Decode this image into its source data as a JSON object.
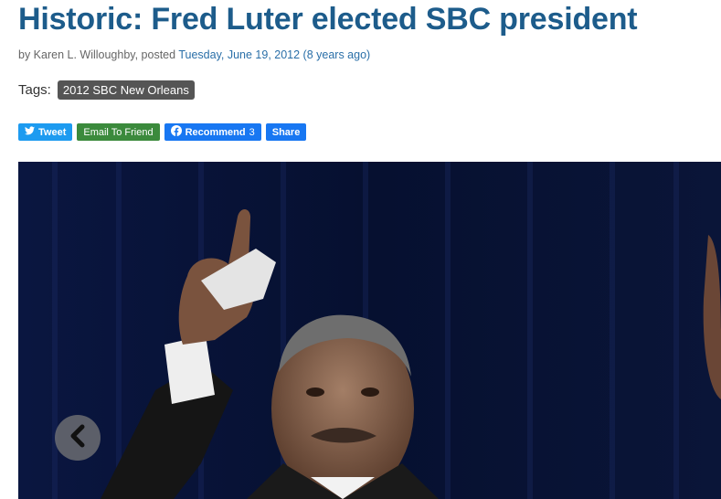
{
  "article": {
    "title": "Historic: Fred Luter elected SBC president",
    "byline_prefix": "by Karen L. Willoughby, posted ",
    "date_link": "Tuesday, June 19, 2012 (8 years ago)"
  },
  "tags": {
    "label": "Tags:",
    "items": [
      "2012 SBC New Orleans"
    ]
  },
  "share": {
    "tweet_label": "Tweet",
    "email_label": "Email To Friend",
    "recommend_label": "Recommend",
    "recommend_count": "3",
    "share_label": "Share"
  },
  "colors": {
    "headline": "#1d5c8b",
    "link": "#2a6fa8",
    "tweet": "#1d9bf0",
    "email": "#3b8a3c",
    "facebook": "#1877f2",
    "tag_bg": "#555555"
  },
  "slideshow": {
    "prev_icon": "chevron-left-icon"
  }
}
